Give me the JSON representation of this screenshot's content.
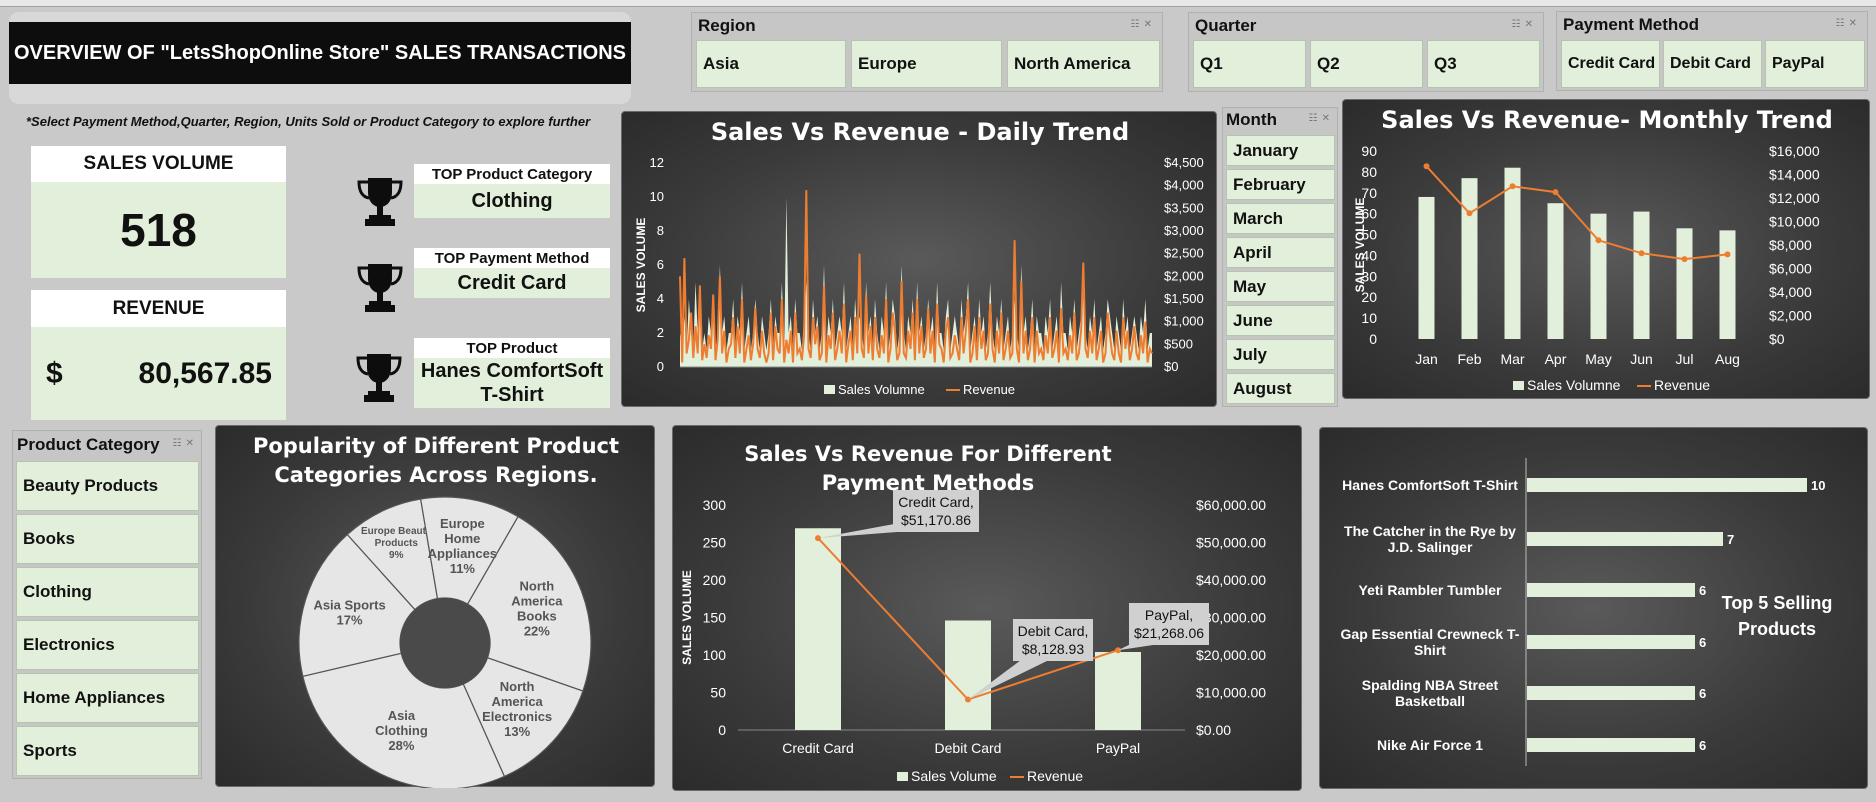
{
  "header": {
    "title": "OVERVIEW OF \"LetsShopOnline Store\" SALES TRANSACTIONS",
    "hint": "*Select Payment Method,Quarter, Region, Units Sold or Product Category to explore further"
  },
  "kpis": {
    "sales_volume_label": "SALES VOLUME",
    "sales_volume_value": "518",
    "revenue_label": "REVENUE",
    "revenue_currency": "$",
    "revenue_value": "80,567.85"
  },
  "tops": [
    {
      "label": "TOP Product Category",
      "value": "Clothing"
    },
    {
      "label": "TOP Payment Method",
      "value": "Credit Card"
    },
    {
      "label": "TOP Product",
      "value": "Hanes ComfortSoft T-Shirt"
    }
  ],
  "slicers": {
    "region": {
      "title": "Region",
      "items": [
        "Asia",
        "Europe",
        "North America"
      ]
    },
    "quarter": {
      "title": "Quarter",
      "items": [
        "Q1",
        "Q2",
        "Q3"
      ]
    },
    "payment": {
      "title": "Payment Method",
      "items": [
        "Credit Card",
        "Debit Card",
        "PayPal"
      ]
    },
    "month": {
      "title": "Month",
      "items": [
        "January",
        "February",
        "March",
        "April",
        "May",
        "June",
        "July",
        "August"
      ]
    },
    "category": {
      "title": "Product Category",
      "items": [
        "Beauty Products",
        "Books",
        "Clothing",
        "Electronics",
        "Home Appliances",
        "Sports"
      ]
    }
  },
  "colors": {
    "bar": "#e2efda",
    "line": "#ed7d31",
    "panel": "#3a3a3a"
  },
  "icons": {
    "trophy": "trophy-icon",
    "multi_select": "multi-select-icon",
    "clear_filter": "clear-filter-icon"
  },
  "chart_data": [
    {
      "type": "line",
      "title": "Sales Vs Revenue - Daily Trend",
      "ylabel": "SALES VOLUME",
      "ylim": [
        0,
        12
      ],
      "y_ticks": [
        "0",
        "2",
        "4",
        "6",
        "8",
        "10",
        "12"
      ],
      "y2lim": [
        0,
        4500
      ],
      "y2_ticks": [
        "$0",
        "$500",
        "$1,000",
        "$1,500",
        "$2,000",
        "$2,500",
        "$3,000",
        "$3,500",
        "$4,000",
        "$4,500"
      ],
      "legend": [
        "Sales Volumne",
        "Revenue"
      ],
      "legend_position": "bottom",
      "series": [
        {
          "name": "Sales Volumne",
          "style": "area",
          "values": [
            2,
            1,
            3,
            1,
            4,
            2,
            1,
            5,
            2,
            3,
            1,
            2,
            1,
            3,
            2,
            4,
            1,
            2,
            6,
            2,
            3,
            1,
            2,
            2,
            4,
            1,
            3,
            2,
            5,
            1,
            2,
            3,
            1,
            2,
            4,
            2,
            1,
            3,
            2,
            1,
            2,
            4,
            1,
            3,
            2,
            2,
            5,
            1,
            10,
            2,
            3,
            1,
            4,
            2,
            2,
            1,
            3,
            5,
            2,
            1,
            4,
            2,
            3,
            1,
            2,
            6,
            1,
            3,
            2,
            4,
            1,
            2,
            3,
            2,
            5,
            1,
            2,
            3,
            1,
            4,
            2,
            3,
            2,
            1,
            5,
            2,
            3,
            1,
            4,
            2,
            1,
            3,
            2,
            5,
            1,
            2,
            4,
            3,
            1,
            2,
            6,
            2,
            1,
            3,
            2,
            4,
            1,
            5,
            2,
            3,
            1,
            2,
            4,
            2,
            3,
            1,
            5,
            2,
            2,
            1,
            3,
            4,
            1,
            2,
            3,
            2,
            1,
            4,
            2,
            3,
            5,
            1,
            2,
            3,
            1,
            4,
            2,
            3,
            1,
            2,
            5,
            2,
            1,
            3,
            2,
            4,
            1,
            2,
            3,
            1,
            2,
            4,
            2,
            1,
            6,
            2,
            3,
            1,
            2,
            4,
            1,
            3,
            2,
            2,
            1,
            3,
            2,
            4,
            1,
            2,
            3,
            1,
            5,
            2,
            2,
            1,
            3,
            2,
            4,
            1,
            2,
            3,
            6,
            2,
            1,
            3,
            2,
            4,
            1,
            2,
            3,
            1,
            2,
            4,
            3,
            2,
            1,
            3,
            2,
            1,
            4,
            2,
            3,
            1,
            2,
            3,
            2,
            1,
            3,
            2,
            4,
            1,
            2,
            2
          ]
        },
        {
          "name": "Revenue",
          "style": "line",
          "values": [
            2000,
            100,
            2400,
            300,
            600,
            1200,
            200,
            900,
            300,
            1800,
            150,
            500,
            200,
            700,
            400,
            1600,
            150,
            600,
            2000,
            300,
            800,
            100,
            400,
            500,
            1100,
            200,
            900,
            300,
            1500,
            100,
            400,
            700,
            150,
            500,
            1300,
            400,
            200,
            800,
            300,
            100,
            300,
            1200,
            150,
            900,
            400,
            300,
            1500,
            100,
            600,
            300,
            800,
            100,
            1200,
            300,
            400,
            150,
            700,
            3900,
            400,
            200,
            1100,
            500,
            900,
            150,
            300,
            1800,
            100,
            700,
            400,
            1200,
            150,
            400,
            800,
            300,
            1400,
            100,
            500,
            800,
            150,
            1100,
            300,
            2500,
            400,
            200,
            1600,
            300,
            900,
            150,
            1100,
            400,
            200,
            700,
            300,
            1500,
            100,
            400,
            1200,
            800,
            150,
            300,
            1900,
            300,
            200,
            800,
            400,
            1200,
            150,
            1500,
            300,
            900,
            200,
            400,
            1300,
            300,
            800,
            100,
            1400,
            500,
            400,
            100,
            800,
            1100,
            200,
            300,
            700,
            400,
            150,
            1100,
            300,
            800,
            1500,
            100,
            300,
            900,
            150,
            1100,
            400,
            800,
            150,
            300,
            1400,
            400,
            100,
            800,
            300,
            1200,
            150,
            400,
            800,
            200,
            300,
            2800,
            400,
            100,
            1900,
            300,
            800,
            150,
            400,
            1100,
            100,
            800,
            300,
            400,
            150,
            700,
            300,
            1100,
            200,
            400,
            800,
            100,
            1300,
            300,
            400,
            150,
            700,
            300,
            1200,
            150,
            300,
            800,
            2300,
            400,
            200,
            800,
            300,
            1100,
            150,
            400,
            800,
            100,
            300,
            1200,
            700,
            300,
            150,
            800,
            300,
            100,
            1100,
            400,
            800,
            150,
            400,
            900,
            300,
            150,
            700,
            300,
            1000,
            100,
            400,
            300
          ]
        }
      ]
    },
    {
      "type": "bar",
      "title": "Sales Vs Revenue- Monthly Trend",
      "ylabel": "SALES VOLUME",
      "categories": [
        "Jan",
        "Feb",
        "Mar",
        "Apr",
        "May",
        "Jun",
        "Jul",
        "Aug"
      ],
      "ylim": [
        0,
        90
      ],
      "y_ticks": [
        "0",
        "10",
        "20",
        "30",
        "40",
        "50",
        "60",
        "70",
        "80",
        "90"
      ],
      "y2lim": [
        0,
        16000
      ],
      "y2_ticks": [
        "$0",
        "$2,000",
        "$4,000",
        "$6,000",
        "$8,000",
        "$10,000",
        "$12,000",
        "$14,000",
        "$16,000"
      ],
      "legend": [
        "Sales Volumne",
        "Revenue"
      ],
      "legend_position": "bottom",
      "series": [
        {
          "name": "Sales Volumne",
          "values": [
            68,
            77,
            82,
            65,
            60,
            61,
            53,
            52
          ]
        },
        {
          "name": "Revenue",
          "values": [
            14700,
            10700,
            13000,
            12500,
            8400,
            7300,
            6800,
            7200
          ]
        }
      ]
    },
    {
      "type": "pie",
      "title": "Popularity of Different Product Categories Across Regions.",
      "slices": [
        {
          "label": "North America Books",
          "value": 22
        },
        {
          "label": "North America Electronics",
          "value": 13
        },
        {
          "label": "Asia Clothing",
          "value": 28
        },
        {
          "label": "Asia Sports",
          "value": 17
        },
        {
          "label": "Europe Beauty Products",
          "value": 9
        },
        {
          "label": "Europe Home Appliances",
          "value": 11
        }
      ],
      "style": "doughnut"
    },
    {
      "type": "bar",
      "title": "Sales Vs Revenue For Different Payment Methods",
      "ylabel": "SALES VOLUME",
      "categories": [
        "Credit Card",
        "Debit Card",
        "PayPal"
      ],
      "ylim": [
        0,
        300
      ],
      "y_ticks": [
        "0",
        "50",
        "100",
        "150",
        "200",
        "250",
        "300"
      ],
      "y2lim": [
        0,
        60000
      ],
      "y2_ticks": [
        "$0.00",
        "$10,000.00",
        "$20,000.00",
        "$30,000.00",
        "$40,000.00",
        "$50,000.00",
        "$60,000.00"
      ],
      "legend": [
        "Sales Volume",
        "Revenue"
      ],
      "legend_position": "bottom",
      "series": [
        {
          "name": "Sales Volume",
          "values": [
            269,
            146,
            104
          ]
        },
        {
          "name": "Revenue",
          "values": [
            51170.86,
            8128.93,
            21268.06
          ],
          "data_labels": [
            "Credit Card, $51,170.86",
            "Debit Card, $8,128.93",
            "PayPal, $21,268.06"
          ]
        }
      ]
    },
    {
      "type": "bar",
      "orientation": "horizontal",
      "title": "Top 5 Selling Products",
      "categories": [
        "Hanes ComfortSoft T-Shirt",
        "The Catcher in the Rye by J.D. Salinger",
        "Yeti Rambler Tumbler",
        "Gap Essential Crewneck T-Shirt",
        "Spalding NBA Street Basketball",
        "Nike Air Force 1"
      ],
      "values": [
        10,
        7,
        6,
        6,
        6,
        6
      ],
      "xlim": [
        0,
        10
      ]
    }
  ]
}
